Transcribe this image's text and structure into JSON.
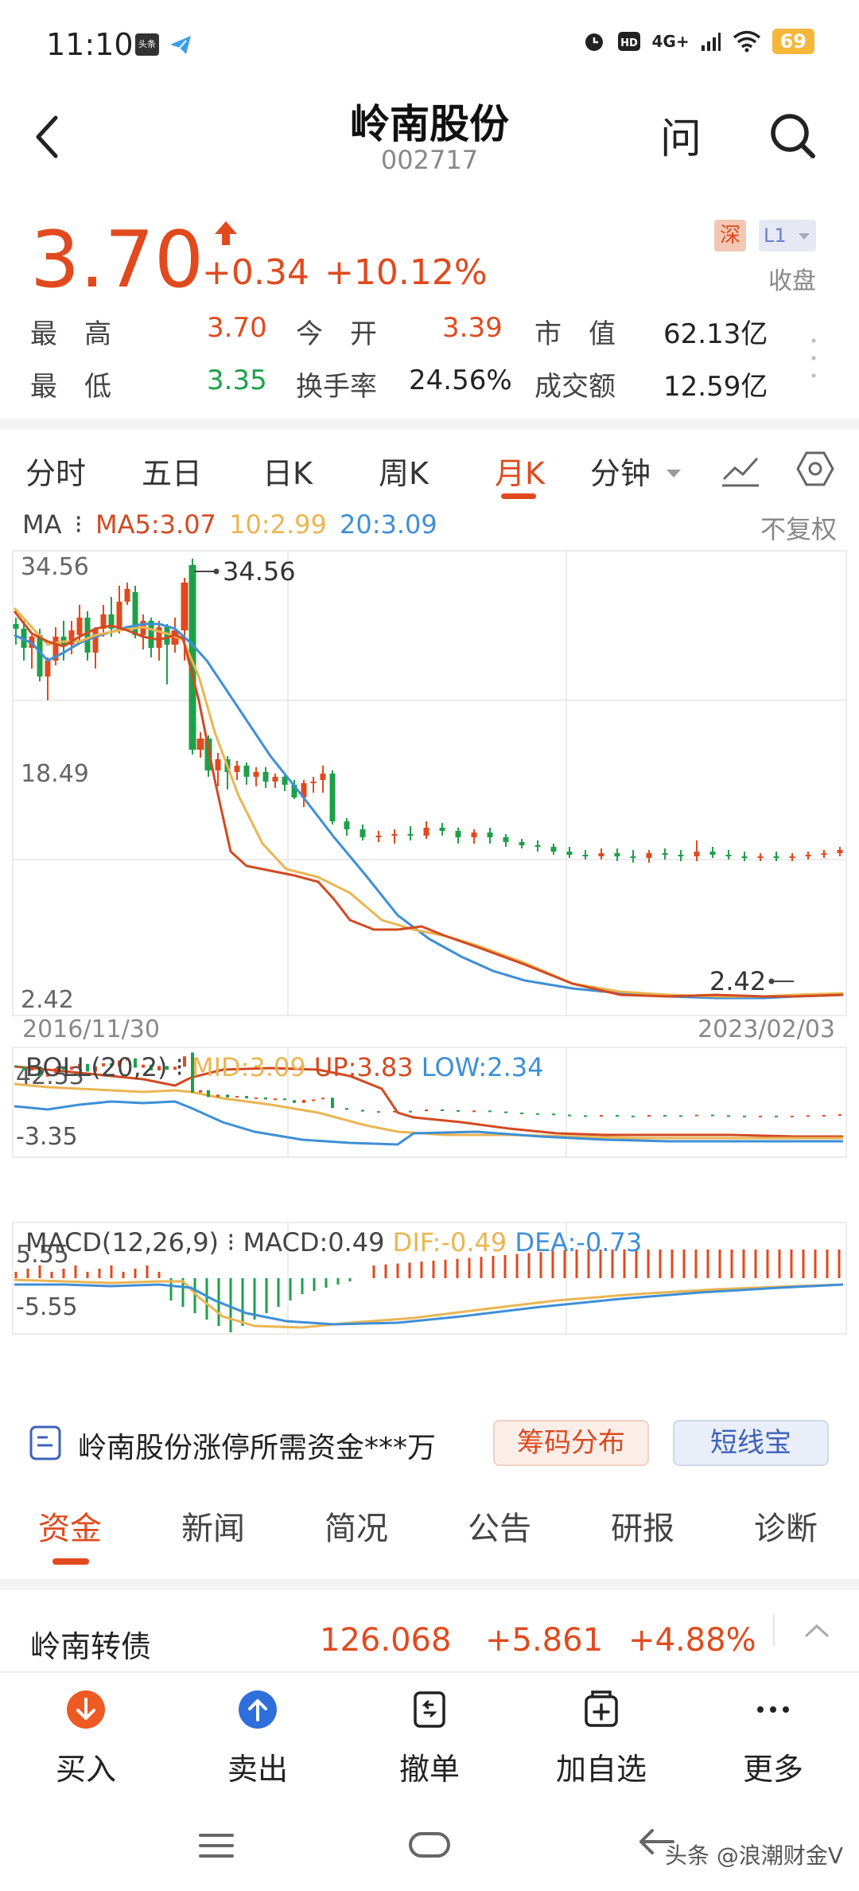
{
  "status": {
    "time": "11:10",
    "app_badge": "头条",
    "net": "4G+",
    "battery": "69"
  },
  "header": {
    "title": "岭南股份",
    "code": "002717",
    "ask_label": "问"
  },
  "quote": {
    "price": "3.70",
    "change": "+0.34",
    "pct": "+10.12%",
    "exchange_badge": "深",
    "level_badge": "L1",
    "session": "收盘",
    "stats": [
      {
        "label": "最　高",
        "value": "3.70",
        "color": "#e04a1e"
      },
      {
        "label": "今　开",
        "value": "3.39",
        "color": "#e04a1e"
      },
      {
        "label": "市　值",
        "value": "62.13亿",
        "color": "#222222"
      },
      {
        "label": "最　低",
        "value": "3.35",
        "color": "#1ea04a"
      },
      {
        "label": "换手率",
        "value": "24.56%",
        "color": "#222222"
      },
      {
        "label": "成交额",
        "value": "12.59亿",
        "color": "#222222"
      }
    ]
  },
  "period_tabs": [
    "分时",
    "五日",
    "日K",
    "周K",
    "月K",
    "分钟"
  ],
  "period_active": "月K",
  "ma_legend": {
    "name": "MA",
    "ma5": "MA5:3.07",
    "ma10": "10:2.99",
    "ma20": "20:3.09",
    "adjust": "不复权"
  },
  "kline": {
    "y_top": "34.56",
    "y_mid": "18.49",
    "y_bottom": "2.42",
    "high_mark": "34.56",
    "low_mark": "2.42",
    "date_start": "2016/11/30",
    "date_end": "2023/02/03"
  },
  "boll": {
    "name": "BOLL(20,2)",
    "mid": "MID:3.09",
    "up": "UP:3.83",
    "low": "LOW:2.34",
    "y_top": "42.53",
    "y_bottom": "-3.35"
  },
  "macd": {
    "name": "MACD(12,26,9)",
    "macd": "MACD:0.49",
    "dif": "DIF:-0.49",
    "dea": "DEA:-0.73",
    "y_top": "5.55",
    "y_bottom": "-5.55"
  },
  "colors": {
    "up": "#e04a1e",
    "down": "#1ea04a",
    "ma5": "#d24a22",
    "ma10": "#eab552",
    "ma20": "#3e8fd6"
  },
  "promo": {
    "text": "岭南股份涨停所需资金***万",
    "chip1": "筹码分布",
    "chip2": "短线宝"
  },
  "info_tabs": [
    "资金",
    "新闻",
    "简况",
    "公告",
    "研报",
    "诊断"
  ],
  "info_active": "资金",
  "bond": {
    "name": "岭南转债",
    "price": "126.068",
    "change": "+5.861",
    "pct": "+4.88%"
  },
  "bottom_bar": [
    {
      "label": "买入",
      "icon": "buy-icon"
    },
    {
      "label": "卖出",
      "icon": "sell-icon"
    },
    {
      "label": "撤单",
      "icon": "cancel-order-icon"
    },
    {
      "label": "加自选",
      "icon": "add-watchlist-icon"
    },
    {
      "label": "更多",
      "icon": "more-icon"
    }
  ],
  "watermark": "头条 @浪潮财金V"
}
